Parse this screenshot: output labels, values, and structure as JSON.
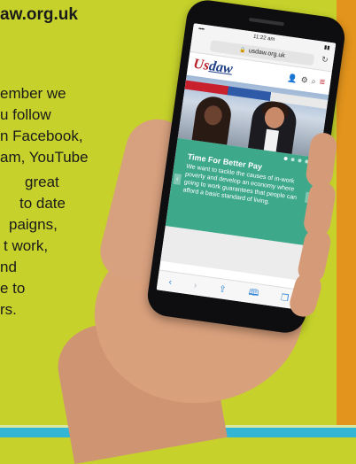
{
  "heading": "aw.org.uk",
  "body_lines": [
    "ember we",
    "u follow",
    "n Facebook,",
    "am, YouTube",
    "great",
    "to date",
    "paigns,",
    "t work,",
    "nd",
    "e to",
    "rs."
  ],
  "phone": {
    "status": {
      "time": "11:22 am",
      "signal": "•••• ",
      "battery": "▮▮"
    },
    "url": "usdaw.org.uk",
    "logo": {
      "main": "Us",
      "accent": "daw"
    },
    "hero": {
      "title": "Time For Better Pay",
      "text": "We want to tackle the causes of in-work poverty and develop an economy where going to work guarantees that people can afford a basic standard of living."
    },
    "toolbar": {
      "back": "‹",
      "forward": "›",
      "share": "⇪",
      "bookmarks": "🕮",
      "tabs": "❐"
    }
  },
  "colors": {
    "background": "#c6d22b",
    "accent_orange": "#e2941c",
    "accent_blue": "#33b5d6",
    "brand_red": "#b81e2a",
    "slide_green": "#3ea88b"
  }
}
